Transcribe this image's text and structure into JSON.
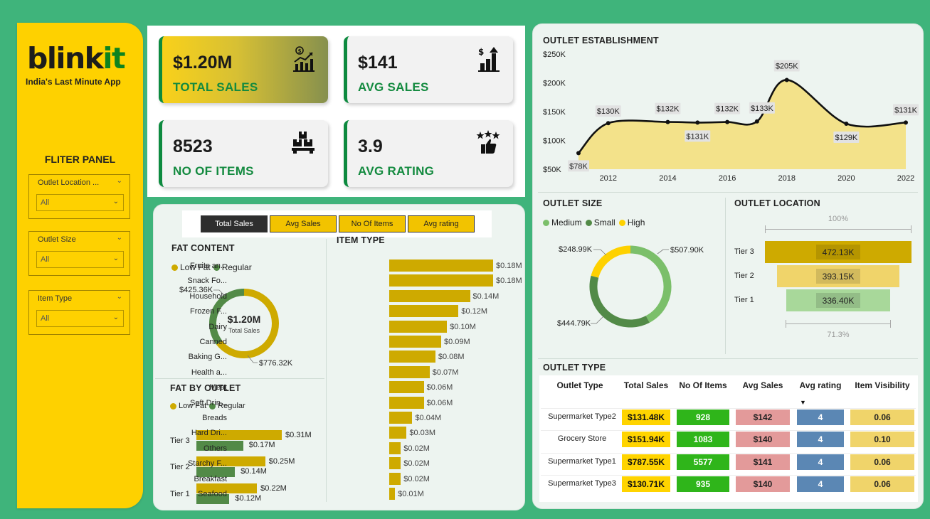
{
  "brand": {
    "name_part1": "blink",
    "name_part2": "it",
    "tagline": "India's Last Minute App"
  },
  "filter_panel": {
    "title": "FLITER PANEL",
    "slicers": [
      {
        "label": "Outlet Location ...",
        "value": "All"
      },
      {
        "label": "Outlet Size",
        "value": "All"
      },
      {
        "label": "Item Type",
        "value": "All"
      }
    ]
  },
  "kpis": {
    "total_sales": {
      "value": "$1.20M",
      "label": "TOTAL SALES",
      "icon": "sales-chart-icon"
    },
    "avg_sales": {
      "value": "$141",
      "label": "AVG SALES",
      "icon": "dollar-growth-icon"
    },
    "no_of_items": {
      "value": "8523",
      "label": "NO OF ITEMS",
      "icon": "boxes-icon"
    },
    "avg_rating": {
      "value": "3.9",
      "label": "AVG RATING",
      "icon": "stars-thumbs-up-icon"
    }
  },
  "metric_buttons": [
    "Total Sales",
    "Avg Sales",
    "No Of Items",
    "Avg rating"
  ],
  "colors": {
    "yellow": "#fed100",
    "green": "#0d8a3f",
    "bar_gold": "#ceaa00",
    "dark_green": "#528a47",
    "light_green": "#7bbf6a"
  },
  "fat_content": {
    "title": "FAT CONTENT",
    "legend": [
      "Low Fat",
      "Regular"
    ],
    "center_value": "$1.20M",
    "center_label": "Total Sales",
    "labels": {
      "regular": "$425.36K",
      "low_fat": "$776.32K"
    }
  },
  "fat_by_outlet": {
    "title": "FAT BY OUTLET",
    "legend": [
      "Low Fat",
      "Regular"
    ],
    "tiers": [
      {
        "tier": "Tier 3",
        "low_fat": "$0.31M",
        "regular": "$0.17M"
      },
      {
        "tier": "Tier 2",
        "low_fat": "$0.25M",
        "regular": "$0.14M"
      },
      {
        "tier": "Tier 1",
        "low_fat": "$0.22M",
        "regular": "$0.12M"
      }
    ]
  },
  "item_type": {
    "title": "ITEM TYPE",
    "items": [
      {
        "name": "Fruits an...",
        "label": "$0.18M"
      },
      {
        "name": "Snack Fo...",
        "label": "$0.18M"
      },
      {
        "name": "Household",
        "label": "$0.14M"
      },
      {
        "name": "Frozen F...",
        "label": "$0.12M"
      },
      {
        "name": "Dairy",
        "label": "$0.10M"
      },
      {
        "name": "Canned",
        "label": "$0.09M"
      },
      {
        "name": "Baking G...",
        "label": "$0.08M"
      },
      {
        "name": "Health a...",
        "label": "$0.07M"
      },
      {
        "name": "Meat",
        "label": "$0.06M"
      },
      {
        "name": "Soft Drin...",
        "label": "$0.06M"
      },
      {
        "name": "Breads",
        "label": "$0.04M"
      },
      {
        "name": "Hard Dri...",
        "label": "$0.03M"
      },
      {
        "name": "Others",
        "label": "$0.02M"
      },
      {
        "name": "Starchy F...",
        "label": "$0.02M"
      },
      {
        "name": "Breakfast",
        "label": "$0.02M"
      },
      {
        "name": "Seafood",
        "label": "$0.01M"
      }
    ]
  },
  "outlet_establishment": {
    "title": "OUTLET ESTABLISHMENT",
    "y_ticks": [
      "$250K",
      "$200K",
      "$150K",
      "$100K",
      "$50K"
    ],
    "x_ticks": [
      "2012",
      "2014",
      "2016",
      "2018",
      "2020",
      "2022"
    ],
    "labels": [
      "$78K",
      "$130K",
      "$132K",
      "$131K",
      "$132K",
      "$133K",
      "$205K",
      "$129K",
      "$131K"
    ]
  },
  "outlet_size": {
    "title": "OUTLET SIZE",
    "legend": [
      "Medium",
      "Small",
      "High"
    ],
    "labels": {
      "medium": "$507.90K",
      "small": "$444.79K",
      "high": "$248.99K"
    }
  },
  "outlet_location": {
    "title": "OUTLET LOCATION",
    "top_pct": "100%",
    "bottom_pct": "71.3%",
    "tiers": [
      {
        "tier": "Tier 3",
        "value": "472.13K"
      },
      {
        "tier": "Tier 2",
        "value": "393.15K"
      },
      {
        "tier": "Tier 1",
        "value": "336.40K"
      }
    ]
  },
  "outlet_type": {
    "title": "OUTLET TYPE",
    "headers": [
      "Outlet Type",
      "Total Sales",
      "No Of Items",
      "Avg Sales",
      "Avg rating",
      "Item Visibility"
    ],
    "rows": [
      {
        "type": "Supermarket Type2",
        "sales": "$131.48K",
        "items": "928",
        "avg": "$142",
        "rating": "4",
        "vis": "0.06"
      },
      {
        "type": "Grocery Store",
        "sales": "$151.94K",
        "items": "1083",
        "avg": "$140",
        "rating": "4",
        "vis": "0.10"
      },
      {
        "type": "Supermarket Type1",
        "sales": "$787.55K",
        "items": "5577",
        "avg": "$141",
        "rating": "4",
        "vis": "0.06"
      },
      {
        "type": "Supermarket Type3",
        "sales": "$130.71K",
        "items": "935",
        "avg": "$140",
        "rating": "4",
        "vis": "0.06"
      }
    ]
  },
  "chart_data": [
    {
      "type": "line",
      "title": "OUTLET ESTABLISHMENT",
      "x": [
        2011,
        2012,
        2014,
        2015,
        2016,
        2017,
        2018,
        2020,
        2022
      ],
      "series": [
        {
          "values": [
            78,
            130,
            132,
            131,
            132,
            133,
            205,
            129,
            131
          ]
        }
      ],
      "unit": "$K",
      "xlim": [
        2011,
        2022
      ],
      "ylim": [
        50,
        250
      ]
    },
    {
      "type": "bar",
      "title": "ITEM TYPE",
      "categories": [
        "Fruits an...",
        "Snack Fo...",
        "Household",
        "Frozen F...",
        "Dairy",
        "Canned",
        "Baking G...",
        "Health a...",
        "Meat",
        "Soft Drin...",
        "Breads",
        "Hard Dri...",
        "Others",
        "Starchy F...",
        "Breakfast",
        "Seafood"
      ],
      "values": [
        0.18,
        0.18,
        0.14,
        0.12,
        0.1,
        0.09,
        0.08,
        0.07,
        0.06,
        0.06,
        0.04,
        0.03,
        0.02,
        0.02,
        0.02,
        0.01
      ],
      "unit": "$M"
    },
    {
      "type": "pie",
      "title": "FAT CONTENT",
      "categories": [
        "Low Fat",
        "Regular"
      ],
      "values": [
        776.32,
        425.36
      ],
      "unit": "$K"
    },
    {
      "type": "pie",
      "title": "OUTLET SIZE",
      "categories": [
        "Medium",
        "Small",
        "High"
      ],
      "values": [
        507.9,
        444.79,
        248.99
      ],
      "unit": "$K"
    },
    {
      "type": "bar",
      "title": "FAT BY OUTLET",
      "categories": [
        "Tier 3",
        "Tier 2",
        "Tier 1"
      ],
      "series": [
        {
          "name": "Low Fat",
          "values": [
            0.31,
            0.25,
            0.22
          ]
        },
        {
          "name": "Regular",
          "values": [
            0.17,
            0.14,
            0.12
          ]
        }
      ],
      "unit": "$M"
    },
    {
      "type": "bar",
      "title": "OUTLET LOCATION",
      "categories": [
        "Tier 3",
        "Tier 2",
        "Tier 1"
      ],
      "values": [
        472.13,
        393.15,
        336.4
      ],
      "unit": "K"
    }
  ]
}
